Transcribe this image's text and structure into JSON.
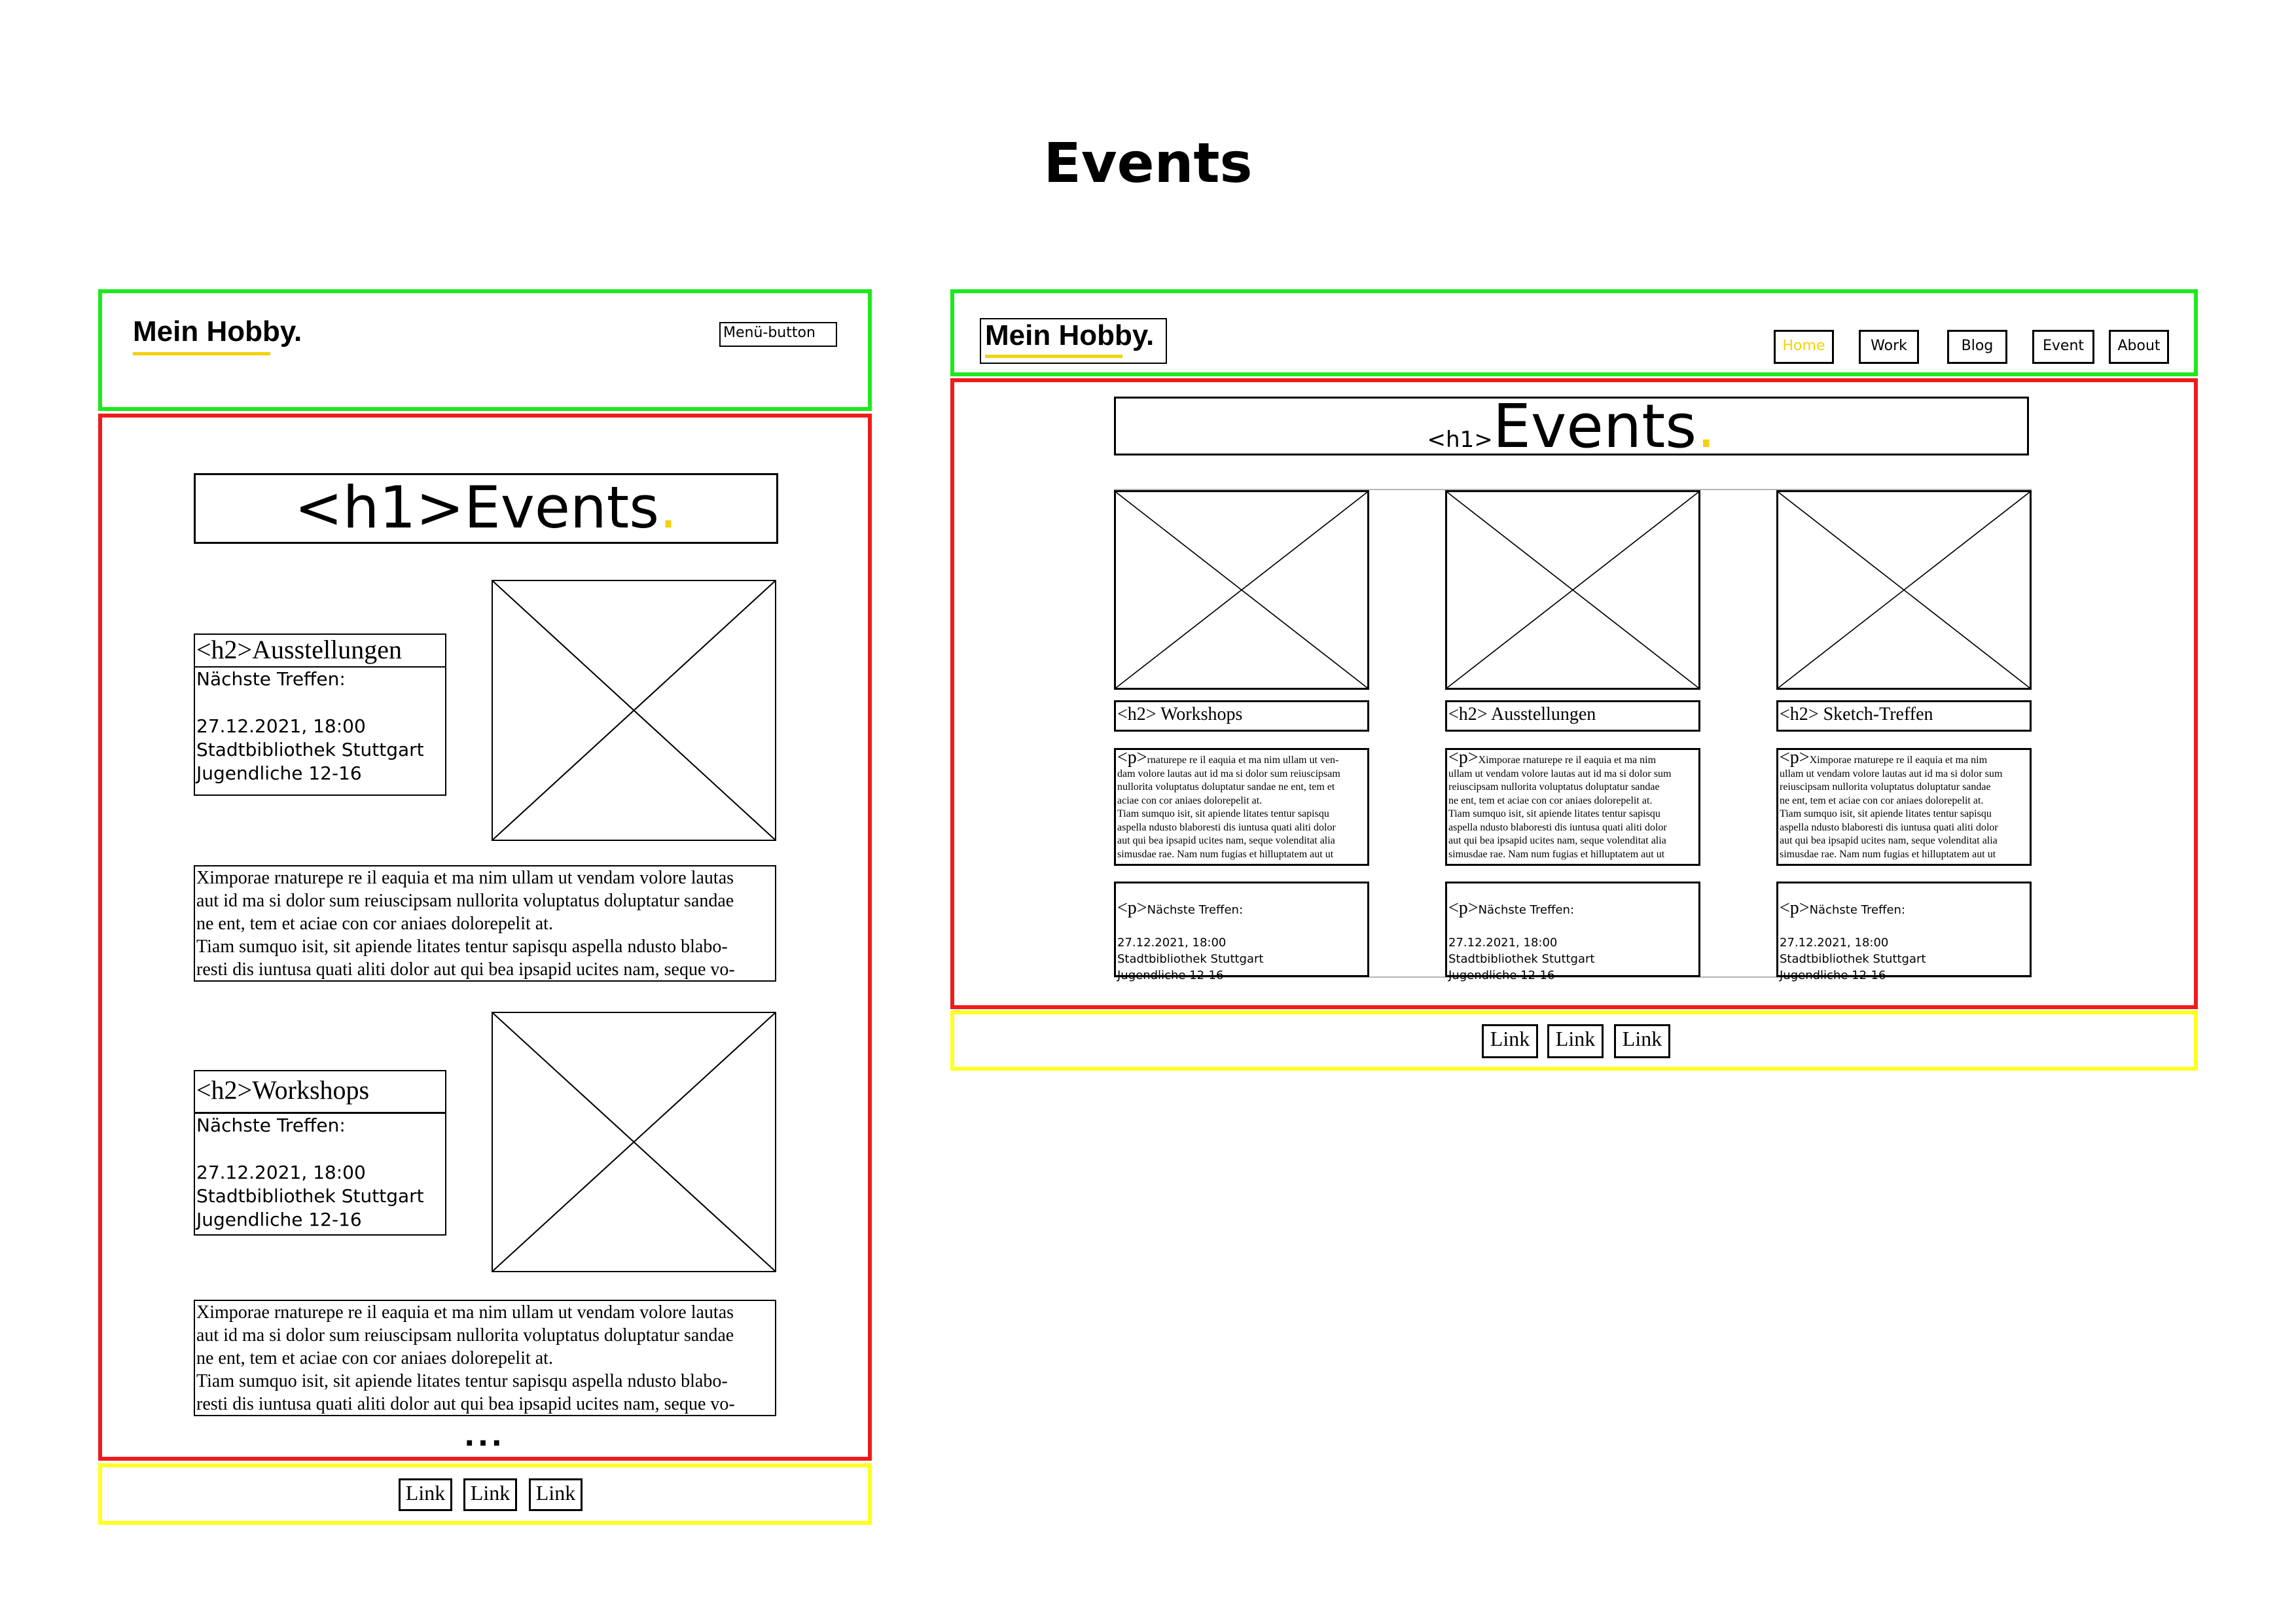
{
  "page": {
    "title": "Events"
  },
  "brand": {
    "logo": "Mein Hobby."
  },
  "mobile": {
    "menu_button": "Menü-button",
    "h1_tag": "<h1>",
    "h1_text": "Events",
    "h1_dot": ".",
    "sections": [
      {
        "h2": "<h2>Ausstellungen",
        "meeting": "Nächste Treffen:\n\n27.12.2021, 18:00\nStadtbibliothek Stuttgart\nJugendliche 12-16",
        "text": "Ximporae rnaturepe re il eaquia et ma nim ullam ut vendam volore lautas\naut id ma si dolor sum reiuscipsam nullorita voluptatus doluptatur sandae\nne ent, tem et aciae con cor aniaes dolorepelit at.\nTiam sumquo isit, sit apiende litates tentur sapisqu aspella ndusto blabo-\nresti dis iuntusa quati aliti dolor aut qui bea ipsapid ucites nam, seque vo-"
      },
      {
        "h2": "<h2>Workshops",
        "meeting": "Nächste Treffen:\n\n27.12.2021, 18:00\nStadtbibliothek Stuttgart\nJugendliche 12-16",
        "text": "Ximporae rnaturepe re il eaquia et ma nim ullam ut vendam volore lautas\naut id ma si dolor sum reiuscipsam nullorita voluptatus doluptatur sandae\nne ent, tem et aciae con cor aniaes dolorepelit at.\nTiam sumquo isit, sit apiende litates tentur sapisqu aspella ndusto blabo-\nresti dis iuntusa quati aliti dolor aut qui bea ipsapid ucites nam, seque vo-"
      }
    ],
    "ellipsis": "...",
    "footer_links": [
      "Link",
      "Link",
      "Link"
    ]
  },
  "desktop": {
    "nav": [
      "Home",
      "Work",
      "Blog",
      "Event",
      "About"
    ],
    "h1_tag": "<h1>",
    "h1_text": "Events",
    "h1_dot": ".",
    "cards": [
      {
        "h2": "<h2> Workshops",
        "p_tag": "<p>",
        "text": "rnaturepe re il eaquia et ma nim ullam ut ven-\ndam volore lautas aut id ma si dolor sum reiuscipsam\nnullorita voluptatus doluptatur sandae ne ent, tem et\naciae con cor aniaes dolorepelit at.\nTiam sumquo isit, sit apiende litates tentur sapisqu\naspella ndusto blaboresti dis iuntusa quati aliti dolor\naut qui bea ipsapid ucites nam, seque volenditat alia\nsimusdae rae. Nam num fugias et hilluptatem aut ut",
        "meet_tag": "<p>",
        "meet_label": "Nächste Treffen:",
        "meet": "27.12.2021, 18:00\nStadtbibliothek Stuttgart\nJugendliche 12-16"
      },
      {
        "h2": "<h2> Ausstellungen",
        "p_tag": "<p>",
        "text": "Ximporae rnaturepe re il eaquia et ma nim\nullam ut vendam volore lautas aut id ma si dolor sum\nreiuscipsam nullorita voluptatus doluptatur sandae\nne ent, tem et aciae con cor aniaes dolorepelit at.\nTiam sumquo isit, sit apiende litates tentur sapisqu\naspella ndusto blaboresti dis iuntusa quati aliti dolor\naut qui bea ipsapid ucites nam, seque volenditat alia\nsimusdae rae. Nam num fugias et hilluptatem aut ut",
        "meet_tag": "<p>",
        "meet_label": "Nächste Treffen:",
        "meet": "27.12.2021, 18:00\nStadtbibliothek Stuttgart\nJugendliche 12-16"
      },
      {
        "h2": "<h2> Sketch-Treffen",
        "p_tag": "<p>",
        "text": "Ximporae rnaturepe re il eaquia et ma nim\nullam ut vendam volore lautas aut id ma si dolor sum\nreiuscipsam nullorita voluptatus doluptatur sandae\nne ent, tem et aciae con cor aniaes dolorepelit at.\nTiam sumquo isit, sit apiende litates tentur sapisqu\naspella ndusto blaboresti dis iuntusa quati aliti dolor\naut qui bea ipsapid ucites nam, seque volenditat alia\nsimusdae rae. Nam num fugias et hilluptatem aut ut",
        "meet_tag": "<p>",
        "meet_label": "Nächste Treffen:",
        "meet": "27.12.2021, 18:00\nStadtbibliothek Stuttgart\nJugendliche 12-16"
      }
    ],
    "footer_links": [
      "Link",
      "Link",
      "Link"
    ]
  },
  "colors": {
    "header": "#1ee81e",
    "main": "#ee1c1c",
    "footer": "#ffff22",
    "accent": "#f5d10a"
  }
}
